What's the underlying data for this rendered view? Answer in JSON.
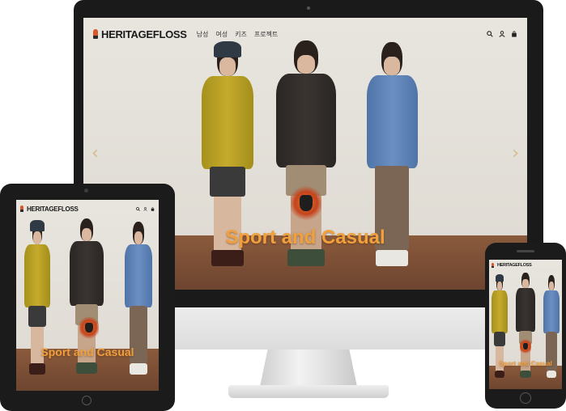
{
  "site": {
    "brand": "HERITAGEFLOSS",
    "nav": [
      {
        "label": "남성"
      },
      {
        "label": "여성"
      },
      {
        "label": "키즈"
      },
      {
        "label": "프로젝트"
      }
    ],
    "header_icons": [
      "search-icon",
      "user-icon",
      "shopping-bag-icon"
    ],
    "hero_title": "Sport and Casual",
    "slider_prev_glyph": "‹",
    "slider_next_glyph": "›"
  },
  "colors": {
    "hero_text": "#f0a03c",
    "logo_mark": "#d8582b",
    "device_frame": "#1b1b1b",
    "backdrop": "#e8e5df",
    "floor": "#8a5a3c"
  }
}
